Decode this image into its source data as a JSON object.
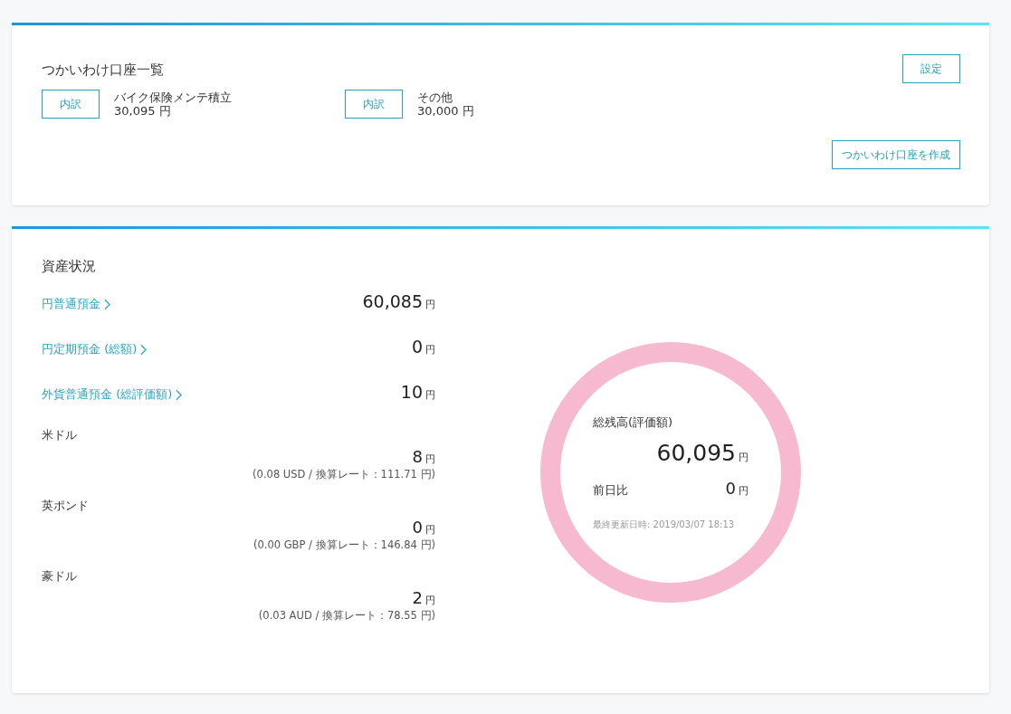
{
  "sub_accounts": {
    "title": "つかいわけ口座一覧",
    "settings_button": "設定",
    "items": [
      {
        "button": "内訳",
        "name": "バイク保険メンテ積立",
        "amount": "30,095 円"
      },
      {
        "button": "内訳",
        "name": "その他",
        "amount": "30,000 円"
      }
    ],
    "create_button": "つかいわけ口座を作成"
  },
  "assets": {
    "title": "資産状況",
    "links": [
      {
        "label": "円普通預金",
        "amount": "60,085",
        "unit": "円"
      },
      {
        "label": "円定期預金 (総額)",
        "amount": "0",
        "unit": "円"
      },
      {
        "label": "外貨普通預金 (総評価額)",
        "amount": "10",
        "unit": "円"
      }
    ],
    "currencies": [
      {
        "name": "米ドル",
        "amount": "8",
        "unit": "円",
        "detail": "(0.08 USD / 換算レート：111.71 円)"
      },
      {
        "name": "英ポンド",
        "amount": "0",
        "unit": "円",
        "detail": "(0.00 GBP / 換算レート：146.84 円)"
      },
      {
        "name": "豪ドル",
        "amount": "2",
        "unit": "円",
        "detail": "(0.03 AUD / 換算レート：78.55 円)"
      }
    ],
    "summary": {
      "label": "総残高(評価額)",
      "total": "60,095",
      "total_unit": "円",
      "diff_label": "前日比",
      "diff": "0",
      "diff_unit": "円",
      "updated": "最終更新日時: 2019/03/07 18:13"
    }
  }
}
